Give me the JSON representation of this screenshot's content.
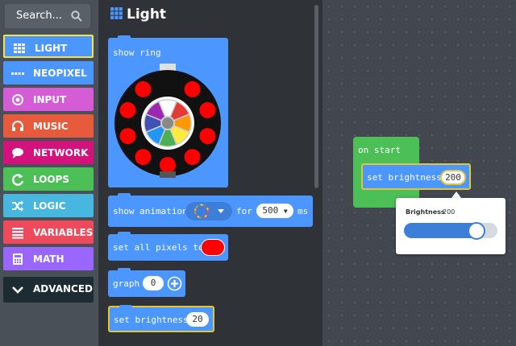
{
  "sidebar": {
    "search_label": "Search...",
    "categories": [
      {
        "label": "LIGHT",
        "color": "#4c97ff",
        "icon": "grid-icon"
      },
      {
        "label": "NEOPIXEL",
        "color": "#4c97ff",
        "icon": "dots-icon"
      },
      {
        "label": "INPUT",
        "color": "#d65cd6",
        "icon": "circle-dot-icon"
      },
      {
        "label": "MUSIC",
        "color": "#e85a3c",
        "icon": "headphones-icon"
      },
      {
        "label": "NETWORK",
        "color": "#d4127c",
        "icon": "chat-icon"
      },
      {
        "label": "LOOPS",
        "color": "#4cbf56",
        "icon": "refresh-icon"
      },
      {
        "label": "LOGIC",
        "color": "#48b7e0",
        "icon": "shuffle-icon"
      },
      {
        "label": "VARIABLES",
        "color": "#ef4a5b",
        "icon": "list-icon"
      },
      {
        "label": "MATH",
        "color": "#9966ff",
        "icon": "calculator-icon"
      },
      {
        "label": "ADVANCED",
        "color": "#1d2b32",
        "icon": "chevron-down-icon"
      }
    ]
  },
  "flyout": {
    "title": "Light",
    "blocks": {
      "show_ring": "show ring",
      "show_animation": "show animation",
      "for_label": "for",
      "animation_ms_value": "500",
      "ms_label": "ms",
      "set_all_pixels": "set all pixels to",
      "graph": "graph",
      "graph_value": "0",
      "set_brightness": "set brightness",
      "brightness_value": "20"
    },
    "ring_colors": [
      "#ffffff",
      "#e53935",
      "#ff9800",
      "#ffeb3b",
      "#4caf50",
      "#2196f3",
      "#3f51b5",
      "#9c27b0"
    ]
  },
  "workspace": {
    "on_start": "on start",
    "set_brightness": "set brightness",
    "brightness_value": "200",
    "popup": {
      "label": "Brightness",
      "value": "200",
      "slider_fraction": 0.78
    }
  }
}
